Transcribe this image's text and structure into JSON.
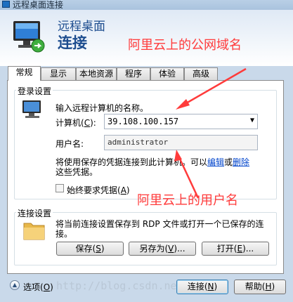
{
  "window": {
    "title": "远程桌面连接",
    "header_line1": "远程桌面",
    "header_line2": "连接"
  },
  "annotations": {
    "server_note": "阿里云上的公网域名",
    "user_note": "阿里云上的用户名",
    "color": "#ff3b3b"
  },
  "tabs": [
    "常规",
    "显示",
    "本地资源",
    "程序",
    "体验",
    "高级"
  ],
  "active_tab": "常规",
  "login_group": {
    "legend": "登录设置",
    "prompt": "输入远程计算机的名称。",
    "computer_label": "计算机(",
    "computer_key": "C",
    "computer_label_end": "):",
    "computer_value": "39.108.100.157",
    "username_label": "用户名:",
    "username_value": "administrator",
    "info_text_1": "将使用保存的凭据连接到此计算机。可以",
    "edit_link": "编辑",
    "or_text": "或",
    "delete_link": "删除",
    "info_text_2": "这些凭据。",
    "always_ask_label": "始终要求凭据(",
    "always_ask_key": "A",
    "always_ask_end": ")"
  },
  "connection_group": {
    "legend": "连接设置",
    "desc_1": "将当前连接设置保存到 RDP 文件或打开一个已保存的连",
    "desc_2": "接。",
    "save_label": "保存(",
    "save_key": "S",
    "save_end": ")",
    "save_as_label": "另存为(",
    "save_as_key": "V",
    "save_as_end": ")...",
    "open_label": "打开(",
    "open_key": "E",
    "open_end": ")..."
  },
  "footer": {
    "options_label": "选项(",
    "options_key": "O",
    "options_end": ")",
    "connect_label": "连接(",
    "connect_key": "N",
    "connect_end": ")",
    "help_label": "帮助(",
    "help_key": "H",
    "help_end": ")",
    "watermark": "http://blog.csdn.net/"
  }
}
